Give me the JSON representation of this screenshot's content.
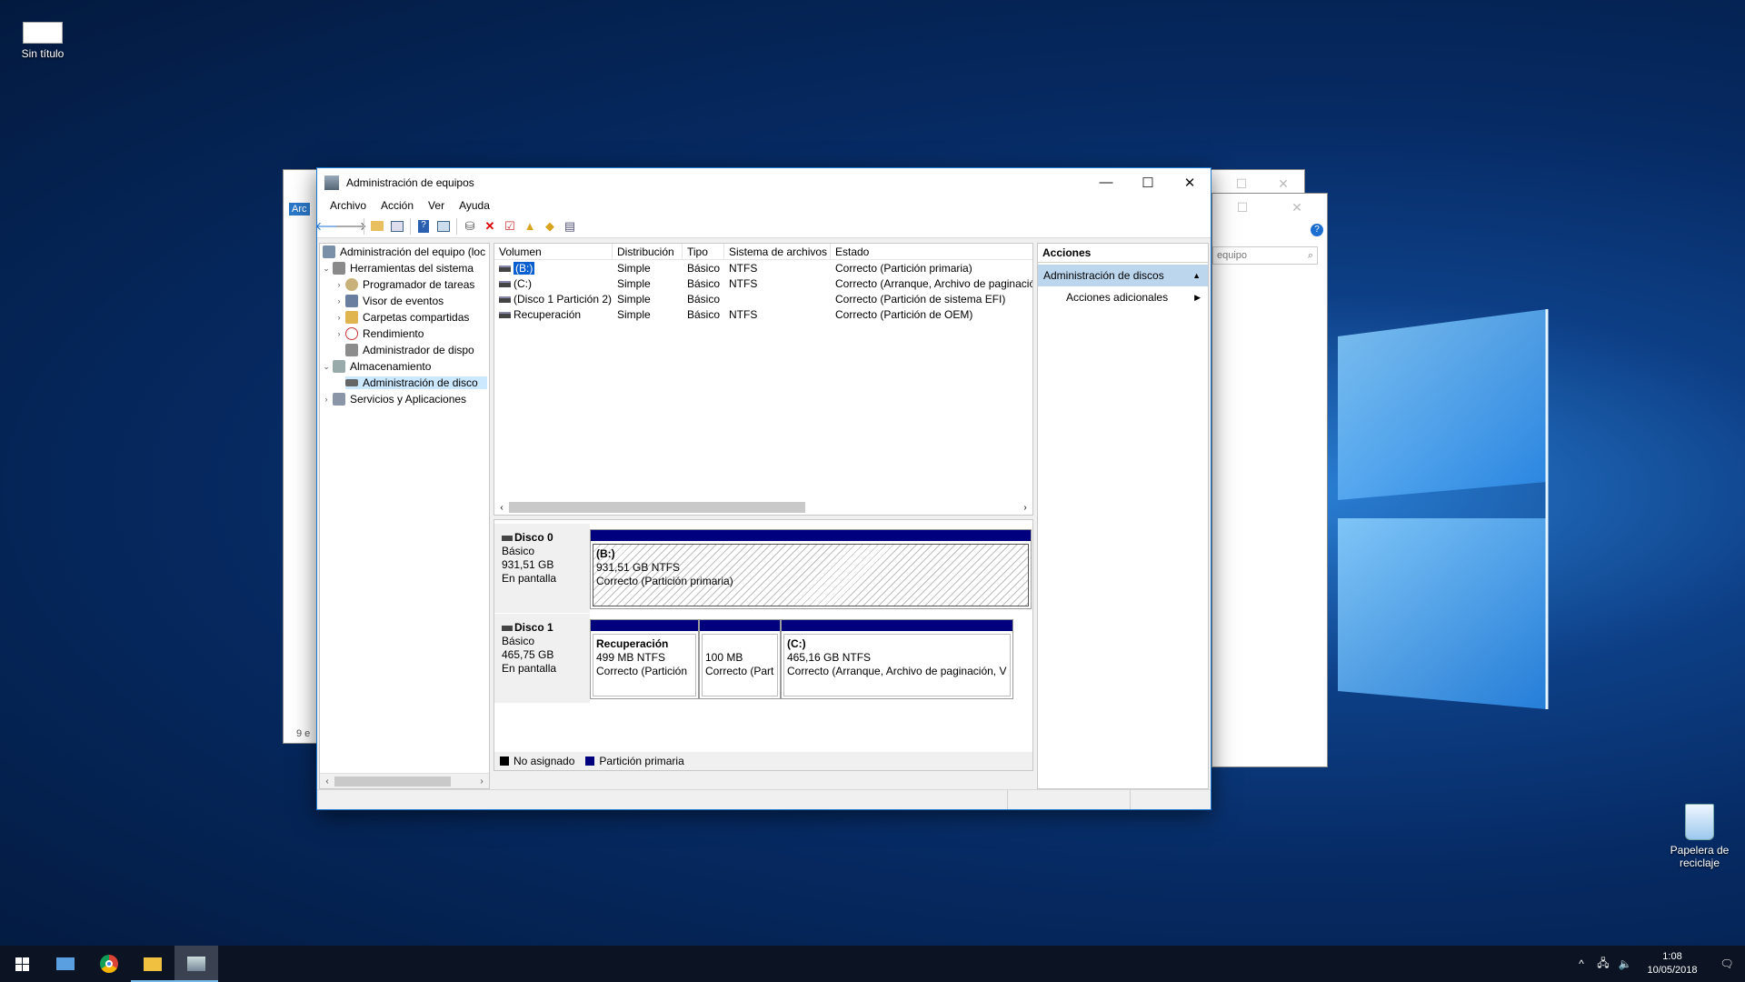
{
  "desktop": {
    "icons": [
      {
        "label": "Sin título",
        "icon": "document-icon"
      },
      {
        "label": "Papelera de reciclaje",
        "icon": "recycle-bin-icon"
      }
    ]
  },
  "bg_window": {
    "tab_text": "Arc",
    "footer_text": "9 e",
    "search_placeholder": "equipo"
  },
  "window": {
    "title": "Administración de equipos",
    "controls": {
      "minimize": "—",
      "maximize": "☐",
      "close": "✕"
    },
    "menu": [
      "Archivo",
      "Acción",
      "Ver",
      "Ayuda"
    ],
    "toolbar_icons": [
      "back-icon",
      "forward-icon",
      "up-folder-icon",
      "show-hide-tree-icon",
      "help-icon",
      "properties-icon",
      "connect-drive-icon",
      "delete-icon",
      "check-icon",
      "folder-up-icon",
      "search-folder-icon",
      "view-list-icon"
    ]
  },
  "tree": {
    "root": "Administración del equipo (loc",
    "items": [
      {
        "label": "Herramientas del sistema",
        "level": 1,
        "expanded": true
      },
      {
        "label": "Programador de tareas",
        "level": 2
      },
      {
        "label": "Visor de eventos",
        "level": 2
      },
      {
        "label": "Carpetas compartidas",
        "level": 2
      },
      {
        "label": "Rendimiento",
        "level": 2
      },
      {
        "label": "Administrador de dispo",
        "level": 2
      },
      {
        "label": "Almacenamiento",
        "level": 1,
        "expanded": true
      },
      {
        "label": "Administración de disco",
        "level": 2,
        "selected": true
      },
      {
        "label": "Servicios y Aplicaciones",
        "level": 1
      }
    ]
  },
  "volumes": {
    "headers": [
      "Volumen",
      "Distribución",
      "Tipo",
      "Sistema de archivos",
      "Estado"
    ],
    "rows": [
      {
        "volume": "(B:)",
        "layout": "Simple",
        "type": "Básico",
        "fs": "NTFS",
        "status": "Correcto (Partición primaria)"
      },
      {
        "volume": "(C:)",
        "layout": "Simple",
        "type": "Básico",
        "fs": "NTFS",
        "status": "Correcto (Arranque, Archivo de paginació"
      },
      {
        "volume": "(Disco 1 Partición 2)",
        "layout": "Simple",
        "type": "Básico",
        "fs": "",
        "status": "Correcto (Partición de sistema EFI)"
      },
      {
        "volume": "Recuperación",
        "layout": "Simple",
        "type": "Básico",
        "fs": "NTFS",
        "status": "Correcto (Partición de OEM)"
      }
    ]
  },
  "disks": [
    {
      "name": "Disco 0",
      "kind": "Básico",
      "size": "931,51 GB",
      "state": "En pantalla",
      "partitions": [
        {
          "title": "(B:)",
          "size": "931,51 GB NTFS",
          "status": "Correcto (Partición primaria)"
        }
      ]
    },
    {
      "name": "Disco 1",
      "kind": "Básico",
      "size": "465,75 GB",
      "state": "En pantalla",
      "partitions": [
        {
          "title": "Recuperación",
          "size": "499 MB NTFS",
          "status": "Correcto (Partición"
        },
        {
          "title": "",
          "size": "100 MB",
          "status": "Correcto (Part"
        },
        {
          "title": "(C:)",
          "size": "465,16 GB NTFS",
          "status": "Correcto (Arranque, Archivo de paginación, V"
        }
      ]
    }
  ],
  "legend": [
    {
      "label": "No asignado",
      "color": "#000000"
    },
    {
      "label": "Partición primaria",
      "color": "#00007f"
    }
  ],
  "actions": {
    "title": "Acciones",
    "section": "Administración de discos",
    "items": [
      "Acciones adicionales"
    ]
  },
  "taskbar": {
    "apps": [
      "start-icon",
      "network-user-icon",
      "chrome-icon",
      "file-explorer-icon",
      "computer-management-icon"
    ],
    "time": "1:08",
    "date": "10/05/2018"
  }
}
